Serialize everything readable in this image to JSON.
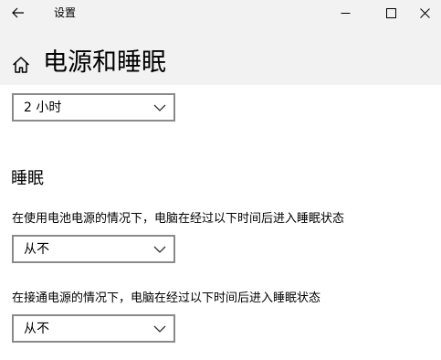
{
  "window": {
    "app_title": "设置",
    "back_icon": "back-arrow-icon",
    "controls": [
      "minimize-icon",
      "maximize-icon",
      "close-icon"
    ]
  },
  "header": {
    "home_icon": "home-icon",
    "title": "电源和睡眠"
  },
  "screen": {
    "timeout_value": "2 小时"
  },
  "sleep": {
    "section_title": "睡眠",
    "battery_label": "在使用电池电源的情况下，电脑在经过以下时间后进入睡眠状态",
    "battery_value": "从不",
    "plugged_label": "在接通电源的情况下，电脑在经过以下时间后进入睡眠状态",
    "plugged_value": "从不"
  }
}
